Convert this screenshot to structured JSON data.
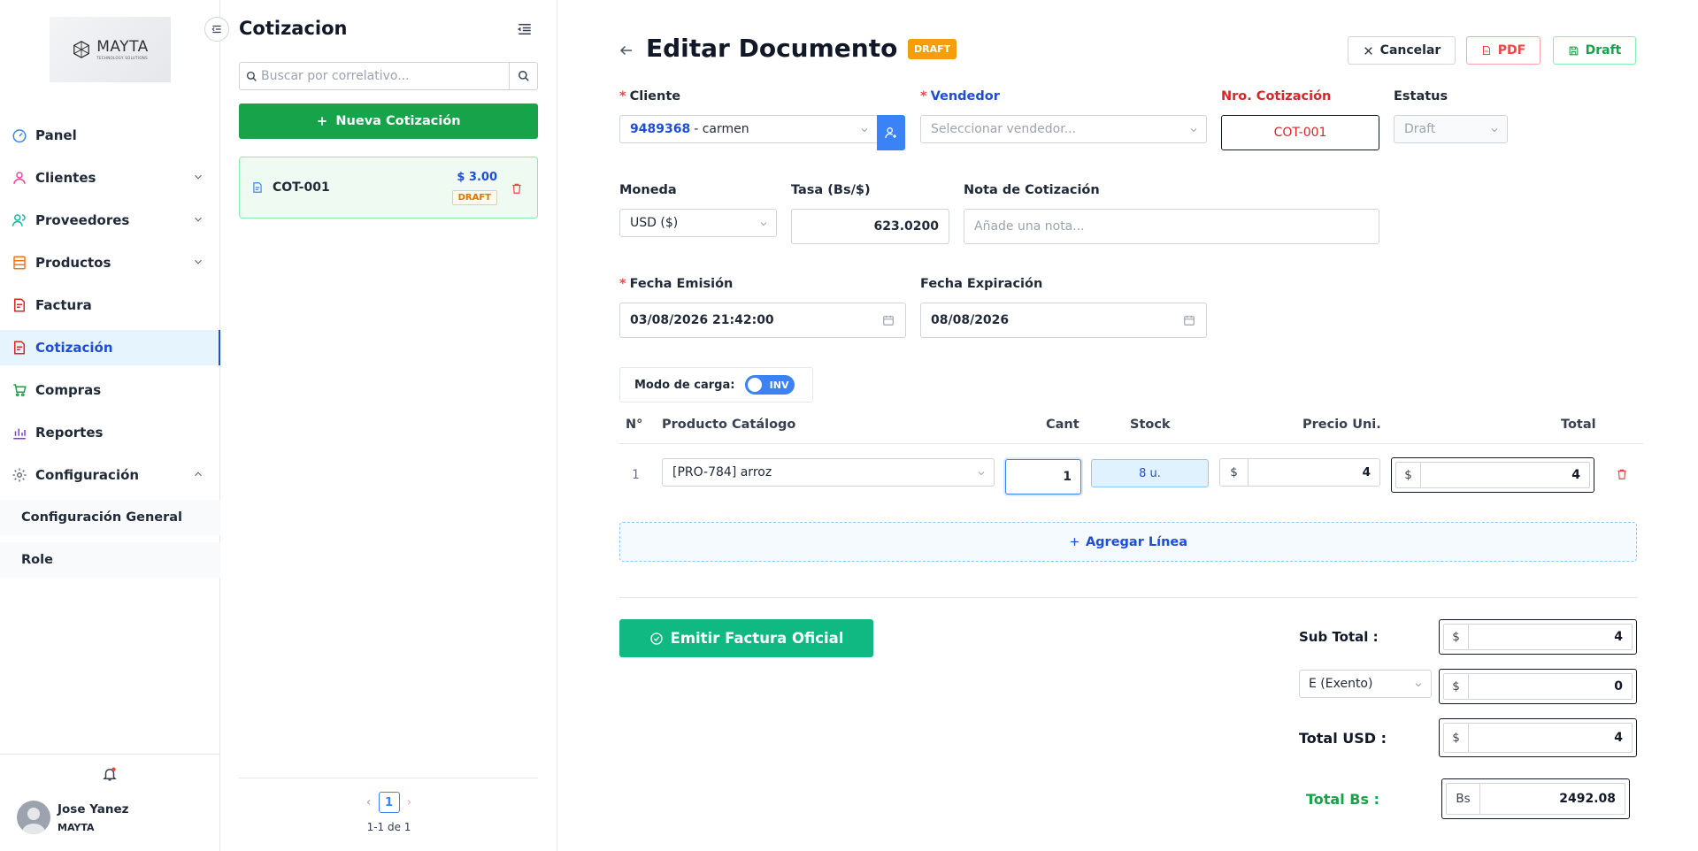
{
  "brand": {
    "name": "MAYTA",
    "tagline": "TECHNOLOGY SOLUTIONS"
  },
  "sidebar": {
    "items": [
      {
        "label": "Panel"
      },
      {
        "label": "Clientes"
      },
      {
        "label": "Proveedores"
      },
      {
        "label": "Productos"
      },
      {
        "label": "Factura"
      },
      {
        "label": "Cotización"
      },
      {
        "label": "Compras"
      },
      {
        "label": "Reportes"
      },
      {
        "label": "Configuración"
      }
    ],
    "sub_items": [
      {
        "label": "Configuración General"
      },
      {
        "label": "Role"
      }
    ],
    "user": {
      "name": "Jose Yanez",
      "org": "MAYTA"
    }
  },
  "list_panel": {
    "title": "Cotizacion",
    "search_placeholder": "Buscar por correlativo...",
    "new_button": "Nueva Cotización",
    "cards": [
      {
        "code": "COT-001",
        "amount": "$ 3.00",
        "status": "DRAFT"
      }
    ],
    "pagination": {
      "current": "1",
      "info": "1-1 de 1"
    }
  },
  "editor": {
    "title": "Editar Documento",
    "status_badge": "DRAFT",
    "buttons": {
      "cancel": "Cancelar",
      "pdf": "PDF",
      "draft": "Draft"
    },
    "cliente": {
      "label": "Cliente",
      "id": "9489368",
      "name": "- carmen"
    },
    "vendedor": {
      "label": "Vendedor",
      "placeholder": "Seleccionar vendedor..."
    },
    "nro": {
      "label": "Nro. Cotización",
      "value": "COT-001"
    },
    "estatus": {
      "label": "Estatus",
      "value": "Draft"
    },
    "moneda": {
      "label": "Moneda",
      "value": "USD ($)"
    },
    "tasa": {
      "label": "Tasa (Bs/$)",
      "value": "623.0200"
    },
    "nota": {
      "label": "Nota de Cotización",
      "placeholder": "Añade una nota..."
    },
    "fecha_emision": {
      "label": "Fecha Emisión",
      "value": "03/08/2026 21:42:00"
    },
    "fecha_expiracion": {
      "label": "Fecha Expiración",
      "value": "08/08/2026"
    },
    "modo_carga": {
      "label": "Modo de carga:",
      "toggle": "INV"
    },
    "table": {
      "headers": {
        "num": "N°",
        "producto": "Producto Catálogo",
        "cant": "Cant",
        "stock": "Stock",
        "precio": "Precio Uni.",
        "total": "Total"
      },
      "rows": [
        {
          "num": "1",
          "producto": "[PRO-784] arroz",
          "cant": "1",
          "stock": "8 u.",
          "currency": "$",
          "precio": "4",
          "total": "4"
        }
      ]
    },
    "add_line": "Agregar Línea",
    "emit_button": "Emitir Factura Oficial",
    "totals": {
      "subtotal_label": "Sub Total :",
      "subtotal_currency": "$",
      "subtotal": "4",
      "tax_option": "E (Exento)",
      "tax_currency": "$",
      "tax": "0",
      "total_usd_label": "Total USD :",
      "total_usd_currency": "$",
      "total_usd": "4",
      "total_bs_label": "Total Bs :",
      "total_bs_currency": "Bs",
      "total_bs": "2492.08"
    }
  },
  "colors": {
    "primary": "#1d4ed8",
    "success": "#16a34a",
    "danger": "#ef4444",
    "warning": "#f59e0b"
  }
}
